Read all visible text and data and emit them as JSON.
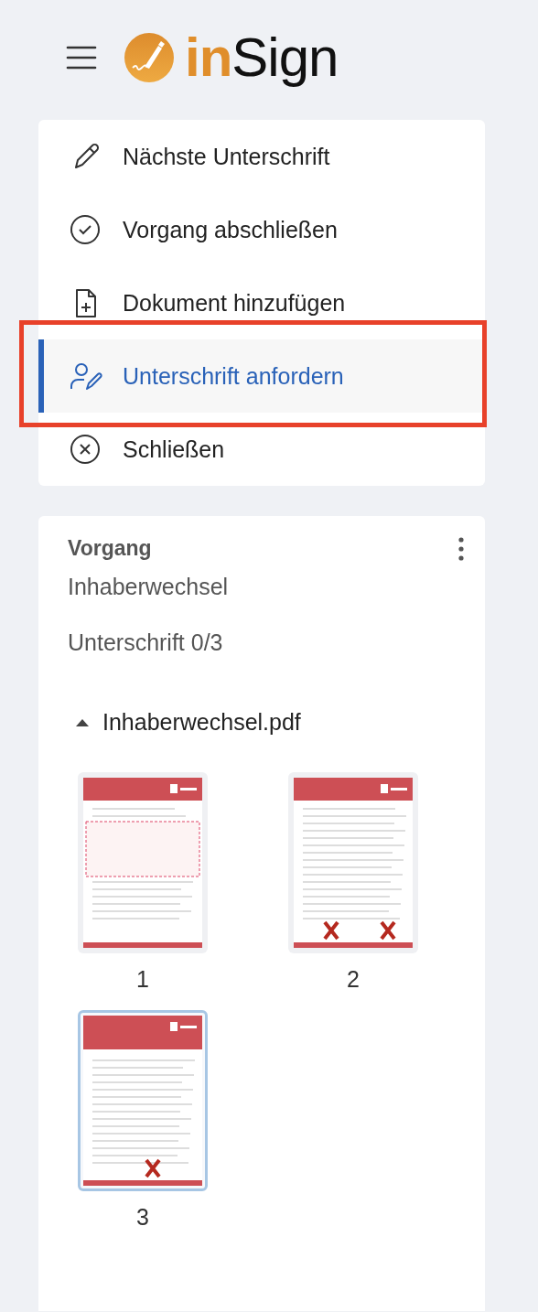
{
  "header": {
    "logo_prefix": "in",
    "logo_suffix": "Sign"
  },
  "menu": [
    {
      "label": "Nächste Unterschrift",
      "selected": false
    },
    {
      "label": "Vorgang abschließen",
      "selected": false
    },
    {
      "label": "Dokument hinzufügen",
      "selected": false
    },
    {
      "label": "Unterschrift anfordern",
      "selected": true
    },
    {
      "label": "Schließen",
      "selected": false
    }
  ],
  "process": {
    "title": "Vorgang",
    "name": "Inhaberwechsel",
    "signature_status": "Unterschrift 0/3",
    "document": {
      "name": "Inhaberwechsel.pdf",
      "expanded": true,
      "pages": [
        {
          "label": "1",
          "selected": false
        },
        {
          "label": "2",
          "selected": false
        },
        {
          "label": "3",
          "selected": true
        }
      ]
    }
  }
}
